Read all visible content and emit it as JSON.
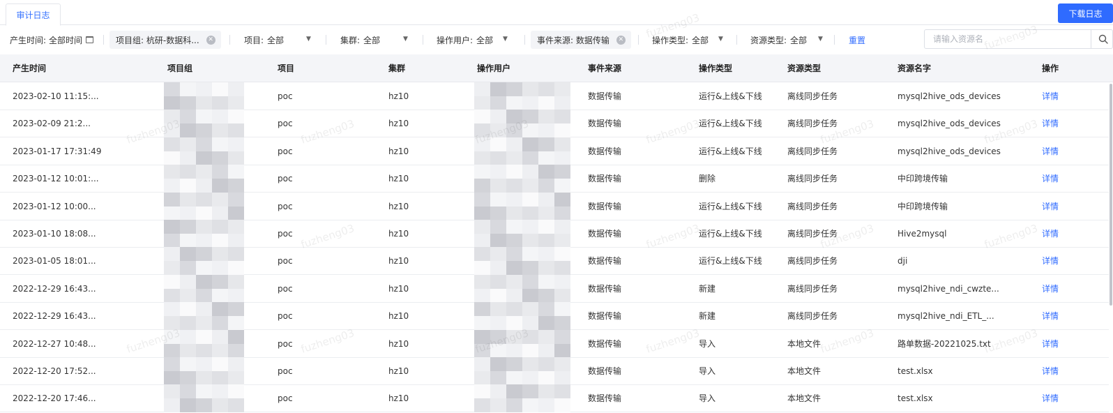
{
  "tab": {
    "label": "审计日志"
  },
  "toolbar": {
    "download_label": "下载日志"
  },
  "filters": {
    "time_label": "产生时间:",
    "time_value": "全部时间",
    "project_group_chip": "项目组: 杭研-数据科...",
    "project_label": "项目:",
    "project_value": "全部",
    "cluster_label": "集群:",
    "cluster_value": "全部",
    "operator_label": "操作用户:",
    "operator_value": "全部",
    "event_source_chip": "事件来源: 数据传输",
    "op_type_label": "操作类型:",
    "op_type_value": "全部",
    "res_type_label": "资源类型:",
    "res_type_value": "全部",
    "reset_label": "重置",
    "search_placeholder": "请输入资源名"
  },
  "watermark_text": "fuzheng03",
  "table": {
    "headers": [
      "产生时间",
      "项目组",
      "项目",
      "集群",
      "操作用户",
      "事件来源",
      "操作类型",
      "资源类型",
      "资源名字",
      "操作"
    ],
    "rows": [
      {
        "time": "2023-02-10 11:15:...",
        "project": "poc",
        "cluster": "hz10",
        "source": "数据传输",
        "op_type": "运行&上线&下线",
        "res_type": "离线同步任务",
        "res_name": "mysql2hive_ods_devices",
        "action": "详情"
      },
      {
        "time": "2023-02-09 21:2...",
        "project": "poc",
        "cluster": "hz10",
        "source": "数据传输",
        "op_type": "运行&上线&下线",
        "res_type": "离线同步任务",
        "res_name": "mysql2hive_ods_devices",
        "action": "详情"
      },
      {
        "time": "2023-01-17 17:31:49",
        "project": "poc",
        "cluster": "hz10",
        "source": "数据传输",
        "op_type": "运行&上线&下线",
        "res_type": "离线同步任务",
        "res_name": "mysql2hive_ods_devices",
        "action": "详情"
      },
      {
        "time": "2023-01-12 10:01:...",
        "project": "poc",
        "cluster": "hz10",
        "source": "数据传输",
        "op_type": "删除",
        "res_type": "离线同步任务",
        "res_name": "中印跨境传输",
        "action": "详情"
      },
      {
        "time": "2023-01-12 10:00...",
        "project": "poc",
        "cluster": "hz10",
        "source": "数据传输",
        "op_type": "运行&上线&下线",
        "res_type": "离线同步任务",
        "res_name": "中印跨境传输",
        "action": "详情"
      },
      {
        "time": "2023-01-10 18:08...",
        "project": "poc",
        "cluster": "hz10",
        "source": "数据传输",
        "op_type": "运行&上线&下线",
        "res_type": "离线同步任务",
        "res_name": "Hive2mysql",
        "action": "详情"
      },
      {
        "time": "2023-01-05 18:01...",
        "project": "poc",
        "cluster": "hz10",
        "source": "数据传输",
        "op_type": "运行&上线&下线",
        "res_type": "离线同步任务",
        "res_name": "dji",
        "action": "详情"
      },
      {
        "time": "2022-12-29 16:43...",
        "project": "poc",
        "cluster": "hz10",
        "source": "数据传输",
        "op_type": "新建",
        "res_type": "离线同步任务",
        "res_name": "mysql2hive_ndi_cwzte...",
        "action": "详情"
      },
      {
        "time": "2022-12-29 16:43...",
        "project": "poc",
        "cluster": "hz10",
        "source": "数据传输",
        "op_type": "新建",
        "res_type": "离线同步任务",
        "res_name": "mysql2hive_ndi_ETL_...",
        "action": "详情"
      },
      {
        "time": "2022-12-27 10:48...",
        "project": "poc",
        "cluster": "hz10",
        "source": "数据传输",
        "op_type": "导入",
        "res_type": "本地文件",
        "res_name": "路单数据-20221025.txt",
        "action": "详情"
      },
      {
        "time": "2022-12-20 17:52...",
        "project": "poc",
        "cluster": "hz10",
        "source": "数据传输",
        "op_type": "导入",
        "res_type": "本地文件",
        "res_name": "test.xlsx",
        "action": "详情"
      },
      {
        "time": "2022-12-20 17:46...",
        "project": "poc",
        "cluster": "hz10",
        "source": "数据传输",
        "op_type": "导入",
        "res_type": "本地文件",
        "res_name": "test.xlsx",
        "action": "详情"
      }
    ]
  }
}
